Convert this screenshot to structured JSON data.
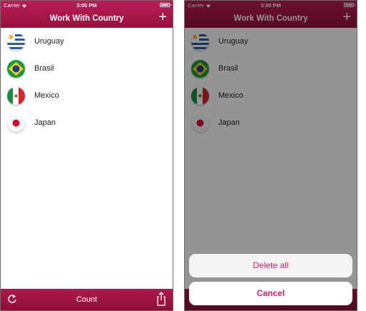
{
  "status": {
    "carrier": "Carrier",
    "time": "3:05 PM"
  },
  "nav": {
    "title": "Work With Country",
    "add_label": "+"
  },
  "countries": [
    {
      "name": "Uruguay",
      "flag": "uruguay-flag-icon"
    },
    {
      "name": "Brasil",
      "flag": "brazil-flag-icon"
    },
    {
      "name": "Mexico",
      "flag": "mexico-flag-icon"
    },
    {
      "name": "Japan",
      "flag": "japan-flag-icon"
    }
  ],
  "toolbar": {
    "count_label": "Count",
    "refresh_icon": "refresh-icon",
    "share_icon": "share-icon"
  },
  "action_sheet": {
    "delete_label": "Delete all",
    "cancel_label": "Cancel"
  },
  "colors": {
    "brand": "#a3164a",
    "action_text": "#e21b6a"
  }
}
